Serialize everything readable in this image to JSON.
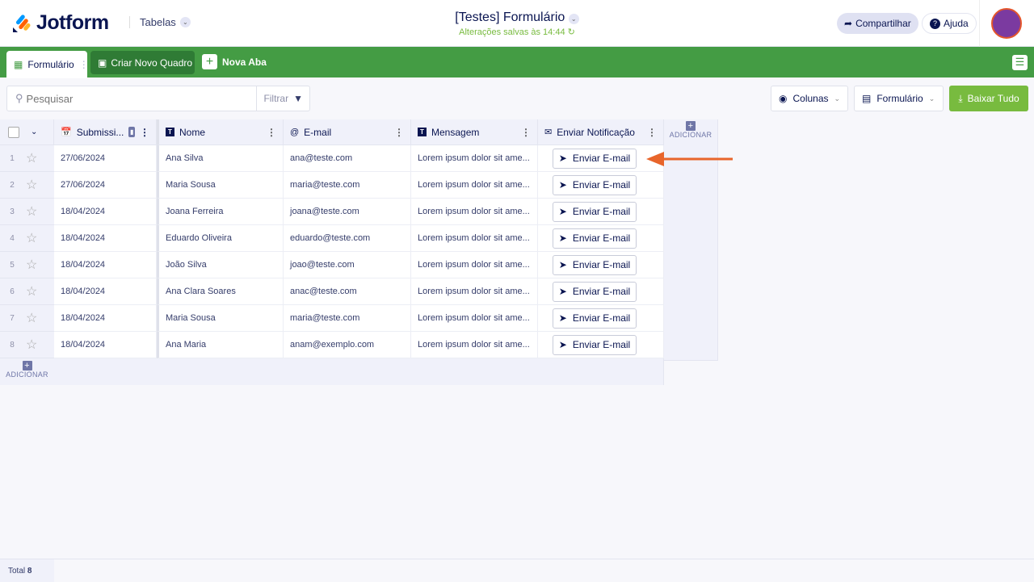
{
  "header": {
    "logo": "Jotform",
    "tables_label": "Tabelas",
    "title": "[Testes] Formulário",
    "saved": "Alterações salvas às 14:44",
    "share": "Compartilhar",
    "help": "Ajuda"
  },
  "tabs": {
    "form": "Formulário",
    "create_board": "Criar Novo Quadro",
    "new_tab": "Nova Aba"
  },
  "toolbar": {
    "search_placeholder": "Pesquisar",
    "filter": "Filtrar",
    "columns": "Colunas",
    "form": "Formulário",
    "download": "Baixar Tudo"
  },
  "columns": [
    "Submissi...",
    "Nome",
    "E-mail",
    "Mensagem",
    "Enviar Notificação"
  ],
  "add_label": "ADICIONAR",
  "rows": [
    {
      "n": "1",
      "date": "27/06/2024",
      "name": "Ana Silva",
      "email": "ana@teste.com",
      "msg": "Lorem ipsum dolor sit ame...",
      "action": "Enviar E-mail"
    },
    {
      "n": "2",
      "date": "27/06/2024",
      "name": "Maria Sousa",
      "email": "maria@teste.com",
      "msg": "Lorem ipsum dolor sit ame...",
      "action": "Enviar E-mail"
    },
    {
      "n": "3",
      "date": "18/04/2024",
      "name": "Joana Ferreira",
      "email": "joana@teste.com",
      "msg": "Lorem ipsum dolor sit ame...",
      "action": "Enviar E-mail"
    },
    {
      "n": "4",
      "date": "18/04/2024",
      "name": "Eduardo Oliveira",
      "email": "eduardo@teste.com",
      "msg": "Lorem ipsum dolor sit ame...",
      "action": "Enviar E-mail"
    },
    {
      "n": "5",
      "date": "18/04/2024",
      "name": "João Silva",
      "email": "joao@teste.com",
      "msg": "Lorem ipsum dolor sit ame...",
      "action": "Enviar E-mail"
    },
    {
      "n": "6",
      "date": "18/04/2024",
      "name": "Ana Clara Soares",
      "email": "anac@teste.com",
      "msg": "Lorem ipsum dolor sit ame...",
      "action": "Enviar E-mail"
    },
    {
      "n": "7",
      "date": "18/04/2024",
      "name": "Maria Sousa",
      "email": "maria@teste.com",
      "msg": "Lorem ipsum dolor sit ame...",
      "action": "Enviar E-mail"
    },
    {
      "n": "8",
      "date": "18/04/2024",
      "name": "Ana Maria",
      "email": "anam@exemplo.com",
      "msg": "Lorem ipsum dolor sit ame...",
      "action": "Enviar E-mail"
    }
  ],
  "footer": {
    "total_label": "Total",
    "total": "8"
  },
  "colors": {
    "green": "#449c44",
    "accent": "#78bb3f",
    "arrow": "#e8652b"
  }
}
